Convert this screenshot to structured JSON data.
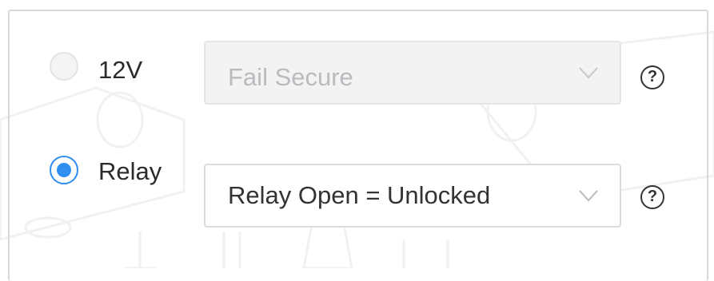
{
  "power_mode": {
    "options": [
      {
        "label": "12V",
        "selected": false,
        "disabled_select_value": "Fail Secure",
        "help_glyph": "?"
      },
      {
        "label": "Relay",
        "selected": true,
        "select_value": "Relay Open = Unlocked",
        "help_glyph": "?"
      }
    ]
  },
  "colors": {
    "accent": "#2f8ef0",
    "border": "#d6d8dc",
    "disabled_text": "#b9bbbe",
    "text": "#2b2b2b"
  },
  "icons": [
    "chevron-down-icon",
    "help-icon"
  ]
}
